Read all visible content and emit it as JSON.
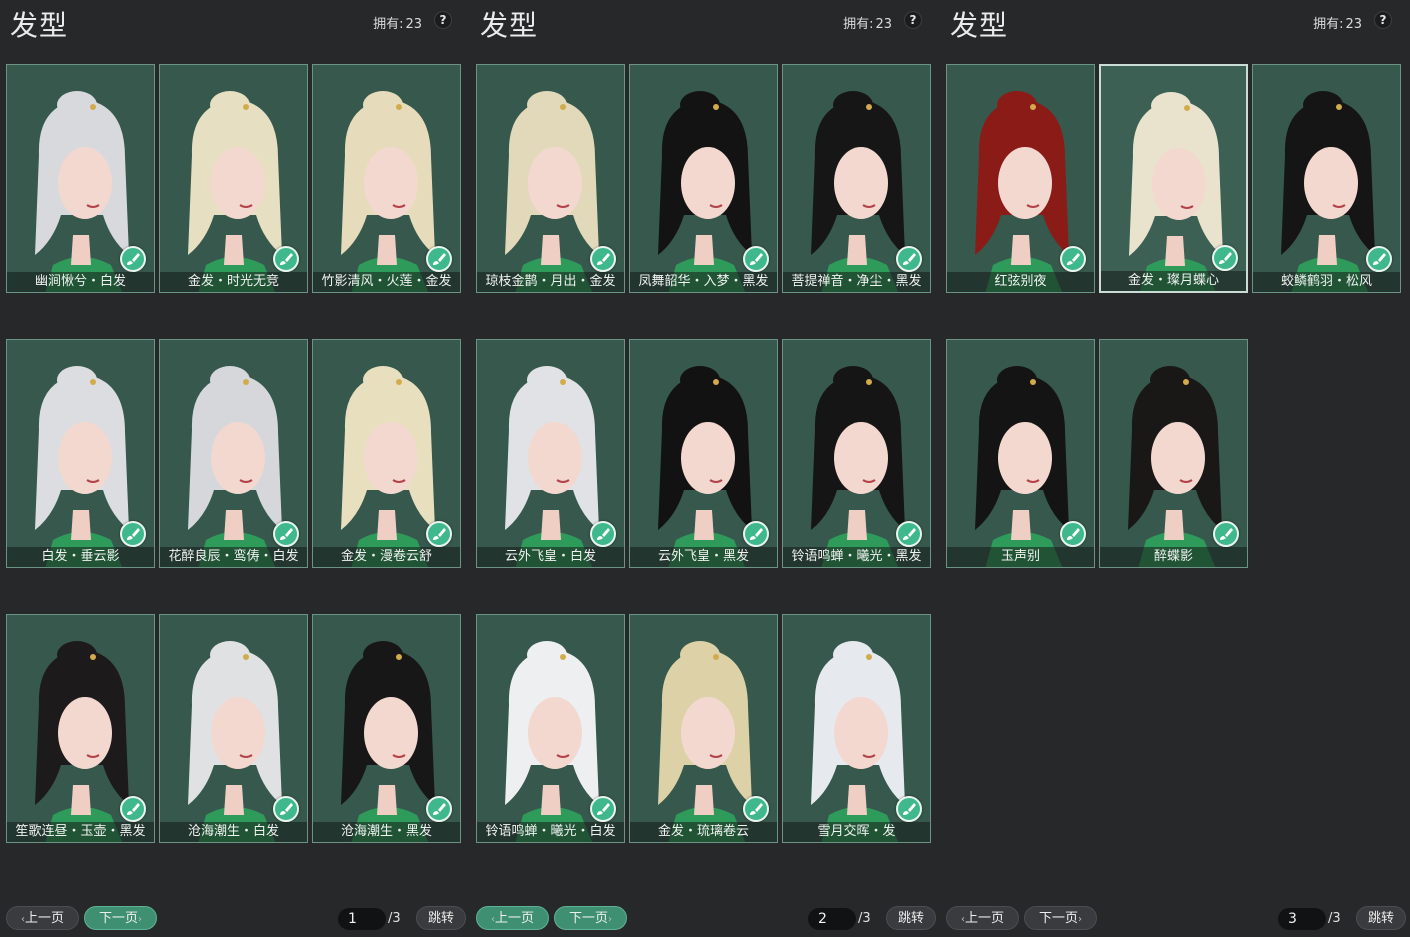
{
  "colors": {
    "card_bg": "#37584d",
    "card_border": "#6c9484",
    "accent_green": "#40b88e",
    "active_button": "#3f8f73",
    "background": "#27282a"
  },
  "panels": [
    {
      "title": "发型",
      "owned_label": "拥有:",
      "owned_count": "23",
      "help_label": "?",
      "items": [
        {
          "label": "幽涧愀兮・白发",
          "hair": "#d8d9dc"
        },
        {
          "label": "金发・时光无竞",
          "hair": "#e7dfc2"
        },
        {
          "label": "竹影清风・火莲・金发",
          "hair": "#e6dcbb"
        },
        {
          "label": "白发・垂云影",
          "hair": "#dcdde0"
        },
        {
          "label": "花醉良辰・鸾俦・白发",
          "hair": "#d5d7da"
        },
        {
          "label": "金发・漫卷云舒",
          "hair": "#e8dfbf"
        },
        {
          "label": "笙歌连昼・玉壶・黑发",
          "hair": "#1c1a1a"
        },
        {
          "label": "沧海潮生・白发",
          "hair": "#e0e1e3"
        },
        {
          "label": "沧海潮生・黑发",
          "hair": "#181717"
        }
      ],
      "pager": {
        "prev_label": "上一页",
        "next_label": "下一页",
        "page": "1",
        "total": "/3",
        "jump_label": "跳转",
        "active": "next"
      }
    },
    {
      "title": "发型",
      "owned_label": "拥有:",
      "owned_count": "23",
      "help_label": "?",
      "items": [
        {
          "label": "琼枝金鹊・月出・金发",
          "hair": "#e2d9bb"
        },
        {
          "label": "凤舞韶华・入梦・黑发",
          "hair": "#141313"
        },
        {
          "label": "菩提禅音・净尘・黑发",
          "hair": "#171616"
        },
        {
          "label": "云外飞皇・白发",
          "hair": "#e1e2e5"
        },
        {
          "label": "云外飞皇・黑发",
          "hair": "#121212"
        },
        {
          "label": "铃语鸣蝉・曦光・黑发",
          "hair": "#161515"
        },
        {
          "label": "铃语鸣蝉・曦光・白发",
          "hair": "#eeeff1"
        },
        {
          "label": "金发・琉璃卷云",
          "hair": "#ddd1a8"
        },
        {
          "label": "雪月交晖・发",
          "hair": "#e6eaee"
        }
      ],
      "pager": {
        "prev_label": "上一页",
        "next_label": "下一页",
        "page": "2",
        "total": "/3",
        "jump_label": "跳转",
        "active": "both"
      }
    },
    {
      "title": "发型",
      "owned_label": "拥有:",
      "owned_count": "23",
      "help_label": "?",
      "items": [
        {
          "label": "红弦别夜",
          "hair": "#8a1b17"
        },
        {
          "label": "金发・璨月蝶心",
          "hair": "#e9e3cd",
          "selected": true
        },
        {
          "label": "蛟鳞鹤羽・松风",
          "hair": "#161515"
        },
        {
          "label": "玉声别",
          "hair": "#141414"
        },
        {
          "label": "醉蝶影",
          "hair": "#1a1717"
        }
      ],
      "pager": {
        "prev_label": "上一页",
        "next_label": "下一页",
        "page": "3",
        "total": "/3",
        "jump_label": "跳转",
        "active": "prev"
      }
    }
  ],
  "icons": {
    "dye": "brush-dye-icon"
  }
}
